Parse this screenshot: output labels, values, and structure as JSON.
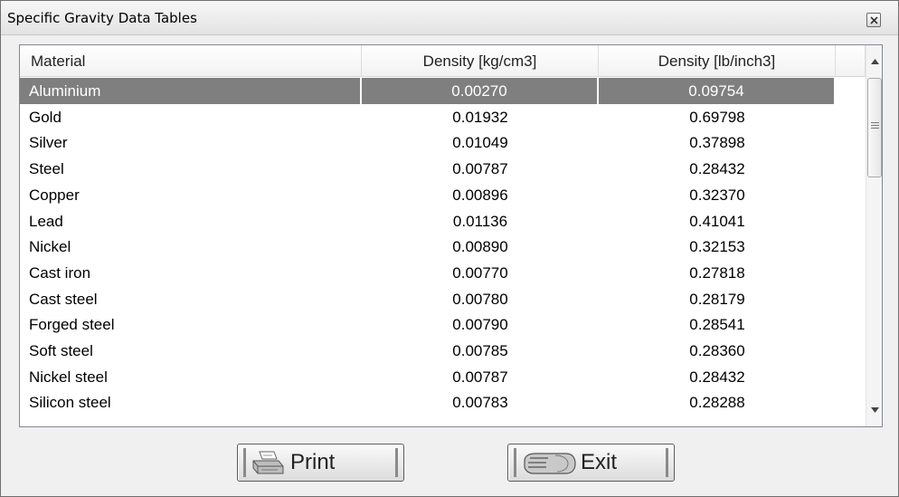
{
  "window": {
    "title": "Specific Gravity Data Tables"
  },
  "table": {
    "columns": [
      "Material",
      "Density [kg/cm3]",
      "Density [lb/inch3]"
    ],
    "selected_row": "Aluminium",
    "rows": [
      {
        "material": "Aluminium",
        "kg_cm3": "0.00270",
        "lb_inch3": "0.09754"
      },
      {
        "material": "Gold",
        "kg_cm3": "0.01932",
        "lb_inch3": "0.69798"
      },
      {
        "material": "Silver",
        "kg_cm3": "0.01049",
        "lb_inch3": "0.37898"
      },
      {
        "material": "Steel",
        "kg_cm3": "0.00787",
        "lb_inch3": "0.28432"
      },
      {
        "material": "Copper",
        "kg_cm3": "0.00896",
        "lb_inch3": "0.32370"
      },
      {
        "material": "Lead",
        "kg_cm3": "0.01136",
        "lb_inch3": "0.41041"
      },
      {
        "material": "Nickel",
        "kg_cm3": "0.00890",
        "lb_inch3": "0.32153"
      },
      {
        "material": "Cast iron",
        "kg_cm3": "0.00770",
        "lb_inch3": "0.27818"
      },
      {
        "material": "Cast steel",
        "kg_cm3": "0.00780",
        "lb_inch3": "0.28179"
      },
      {
        "material": "Forged steel",
        "kg_cm3": "0.00790",
        "lb_inch3": "0.28541"
      },
      {
        "material": "Soft steel",
        "kg_cm3": "0.00785",
        "lb_inch3": "0.28360"
      },
      {
        "material": "Nickel steel",
        "kg_cm3": "0.00787",
        "lb_inch3": "0.28432"
      },
      {
        "material": "Silicon steel",
        "kg_cm3": "0.00783",
        "lb_inch3": "0.28288"
      }
    ]
  },
  "buttons": {
    "print_label": "Print",
    "exit_label": "Exit"
  },
  "icons": {
    "close": "close-icon",
    "print": "printer-icon",
    "exit": "exit-hand-icon",
    "scroll_up": "scroll-up-arrow-icon",
    "scroll_down": "scroll-down-arrow-icon"
  },
  "colors": {
    "selection": "#7f7f7f",
    "window_bg": "#f0f0f0"
  }
}
